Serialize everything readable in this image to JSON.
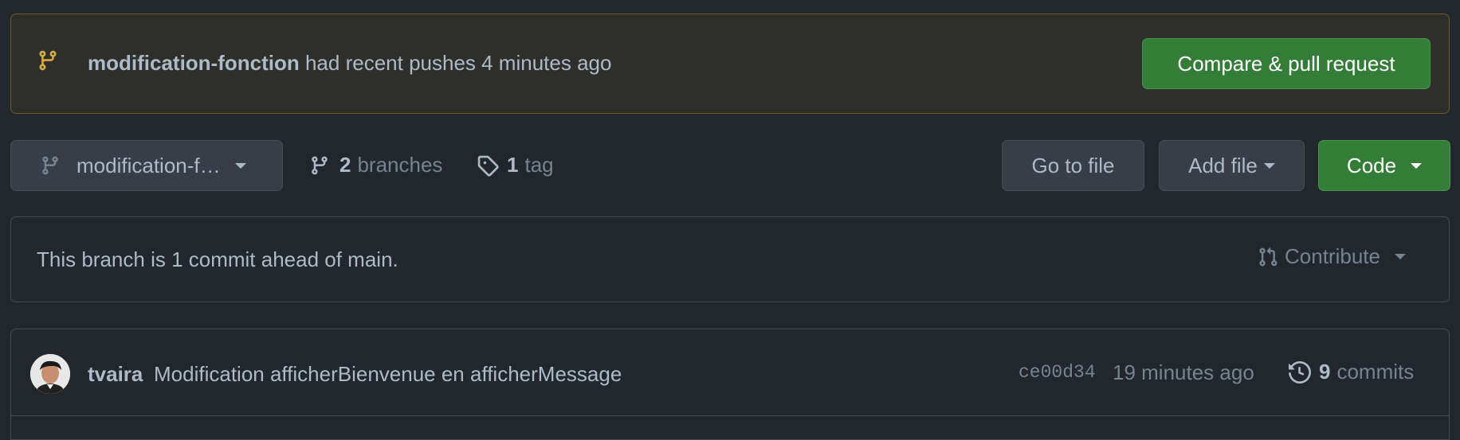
{
  "banner": {
    "branch_name": "modification-fonction",
    "message": " had recent pushes 4 minutes ago",
    "compare_label": "Compare & pull request"
  },
  "toolbar": {
    "branch_select_label": "modification-f…",
    "branches_count": "2",
    "branches_label": "branches",
    "tags_count": "1",
    "tags_label": "tag",
    "go_to_file_label": "Go to file",
    "add_file_label": "Add file",
    "code_label": "Code"
  },
  "ahead": {
    "message": "This branch is 1 commit ahead of main.",
    "contribute_label": "Contribute"
  },
  "latest_commit": {
    "author": "tvaira",
    "message": "Modification afficherBienvenue en afficherMessage",
    "sha": "ce00d34",
    "time": "19 minutes ago",
    "commits_count": "9",
    "commits_label": "commits"
  },
  "colors": {
    "background": "#22272e",
    "banner_border": "#6d5a26",
    "branch_icon_yellow": "#daaa3f",
    "primary_green": "#347d39",
    "muted_text": "#768390"
  },
  "icons": {
    "banner": "git-branch-icon",
    "branch_select": "git-branch-icon",
    "branches": "git-branch-icon",
    "tags": "tag-icon",
    "contribute": "git-pull-request-icon",
    "history": "history-icon"
  }
}
